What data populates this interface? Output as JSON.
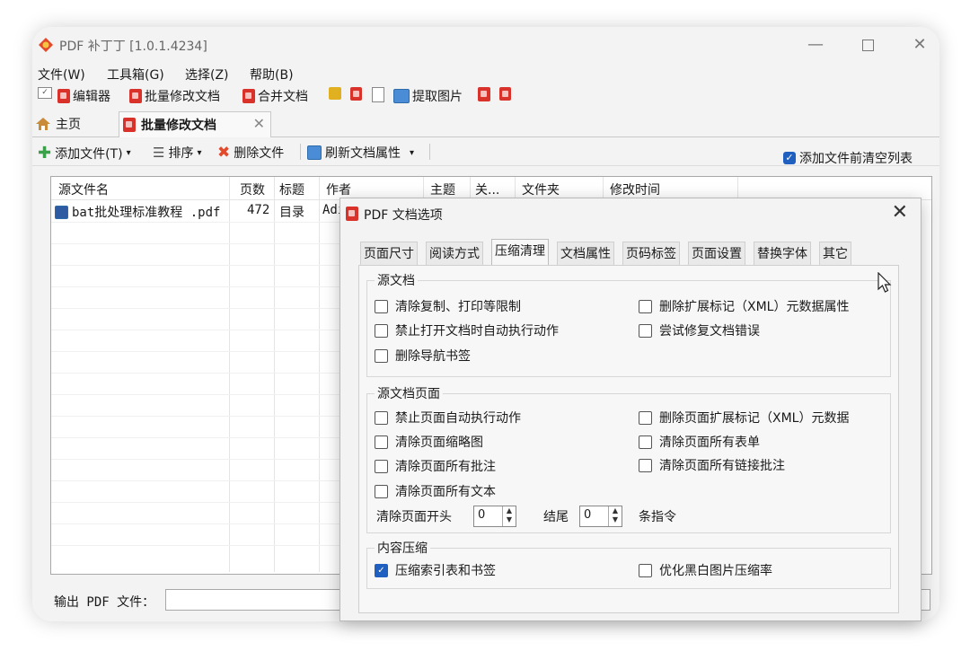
{
  "window": {
    "title": "PDF 补丁丁 [1.0.1.4234]",
    "min_glyph": "—",
    "close_glyph": "✕"
  },
  "menu": [
    "文件(W)",
    "工具箱(G)",
    "选择(Z)",
    "帮助(B)"
  ],
  "toolbar": {
    "editor": "编辑器",
    "batch_modify": "批量修改文档",
    "merge": "合并文档",
    "extract_images": "提取图片"
  },
  "tabs": {
    "home": "主页",
    "active": "批量修改文档",
    "close_glyph": "✕"
  },
  "subtoolbar": {
    "add_files": "添加文件(T)",
    "sort": "排序",
    "delete_files": "删除文件",
    "refresh_props": "刷新文档属性",
    "dropdown_glyph": "▾",
    "clear_before_add": "添加文件前清空列表",
    "clear_before_add_checked": true
  },
  "file_list": {
    "columns": [
      "源文件名",
      "页数",
      "标题",
      "作者",
      "主题",
      "关...",
      "文件夹",
      "修改时间"
    ],
    "rows": [
      {
        "name": "bat批处理标准教程 .pdf",
        "pages": "472",
        "title": "目录",
        "author": "Adı"
      }
    ]
  },
  "output": {
    "label": "输出 PDF 文件：",
    "value": ""
  },
  "dialog": {
    "title": "PDF 文档选项",
    "close_glyph": "✕",
    "tabs": [
      "页面尺寸",
      "阅读方式",
      "压缩清理",
      "文档属性",
      "页码标签",
      "页面设置",
      "替换字体",
      "其它"
    ],
    "active_tab": "压缩清理",
    "groups": {
      "source_doc": {
        "title": "源文档",
        "options": [
          {
            "label": "清除复制、打印等限制",
            "checked": false
          },
          {
            "label": "删除扩展标记（XML）元数据属性",
            "checked": false
          },
          {
            "label": "禁止打开文档时自动执行动作",
            "checked": false
          },
          {
            "label": "尝试修复文档错误",
            "checked": false
          },
          {
            "label": "删除导航书签",
            "checked": false
          }
        ]
      },
      "source_pages": {
        "title": "源文档页面",
        "options": [
          {
            "label": "禁止页面自动执行动作",
            "checked": false
          },
          {
            "label": "删除页面扩展标记（XML）元数据",
            "checked": false
          },
          {
            "label": "清除页面缩略图",
            "checked": false
          },
          {
            "label": "清除页面所有表单",
            "checked": false
          },
          {
            "label": "清除页面所有批注",
            "checked": false
          },
          {
            "label": "清除页面所有链接批注",
            "checked": false
          },
          {
            "label": "清除页面所有文本",
            "checked": false
          }
        ],
        "clear_head_label": "清除页面开头",
        "clear_head_value": "0",
        "tail_label": "结尾",
        "tail_value": "0",
        "instructions_label": "条指令"
      },
      "compression": {
        "title": "内容压缩",
        "options": [
          {
            "label": "压缩索引表和书签",
            "checked": true
          },
          {
            "label": "优化黑白图片压缩率",
            "checked": false
          }
        ]
      }
    }
  },
  "colors": {
    "accent": "#1f5fbf",
    "pdf_red": "#d9322a"
  }
}
